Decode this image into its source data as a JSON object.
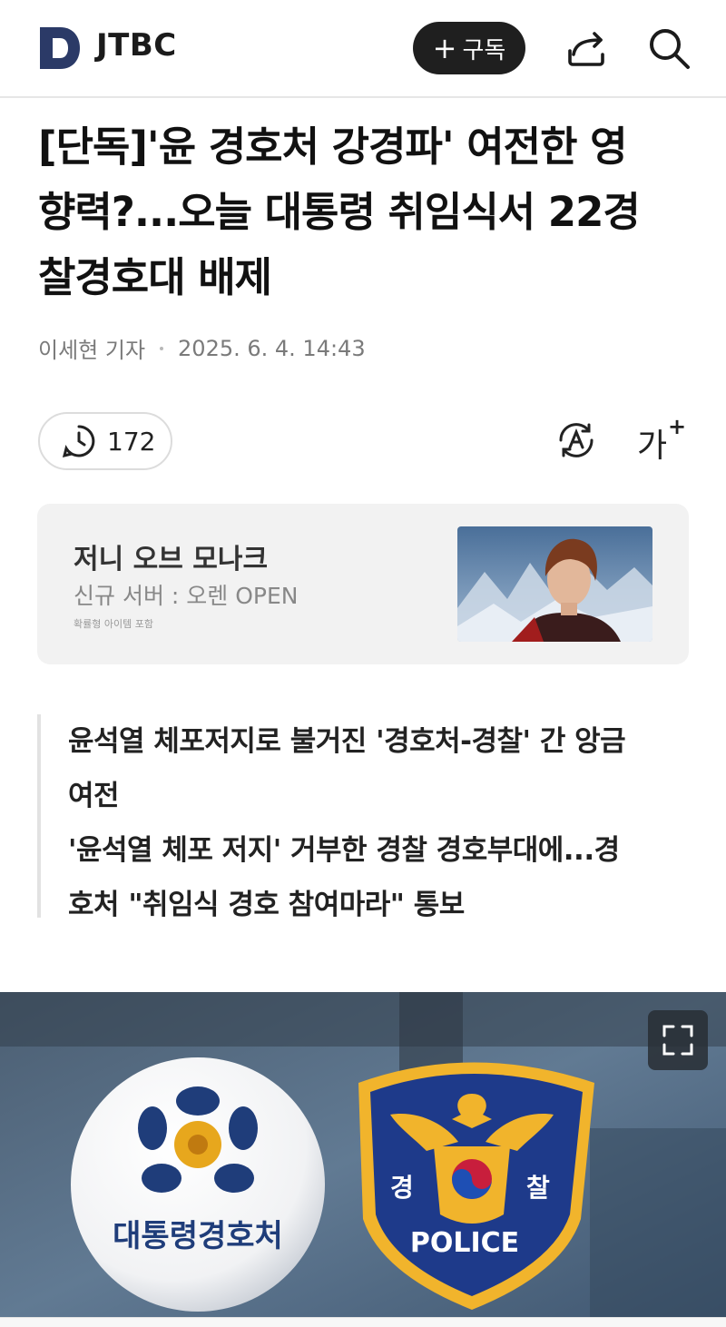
{
  "header": {
    "brand": "JTBC",
    "subscribe_label": "구독",
    "icons": [
      "jtbc-logo-icon",
      "share-icon",
      "search-icon"
    ]
  },
  "article": {
    "headline_lines": [
      "[단독]'윤 경호처 강경파' 여전한 영",
      "향력?...오늘 대통령 취임식서 22경",
      "찰경호대 배제"
    ],
    "reporter": "이세현 기자",
    "datetime": "2025. 6. 4. 14:43",
    "comment_count": "172",
    "font_size_label": "가",
    "font_size_plus": "+"
  },
  "ad": {
    "title": "저니 오브 모나크",
    "subtitle": "신규 서버 : 오렌 OPEN",
    "note": "확률형 아이템 포함"
  },
  "related": [
    "윤석열 체포저지로 불거진 '경호처-경찰' 간 앙금",
    "여전",
    "'윤석열 체포 저지' 거부한 경찰 경호부대에...경",
    "호처 \"취임식 경호 참여마라\" 통보"
  ],
  "photo": {
    "left_emblem_text": "대통령경호처",
    "badge_left": "경",
    "badge_right": "찰",
    "badge_bottom": "POLICE"
  },
  "colors": {
    "brand_navy": "#2b3a67",
    "subscribe_bg": "#1f1f1f",
    "police_blue": "#1e3a8a",
    "police_gold": "#f0b429"
  }
}
